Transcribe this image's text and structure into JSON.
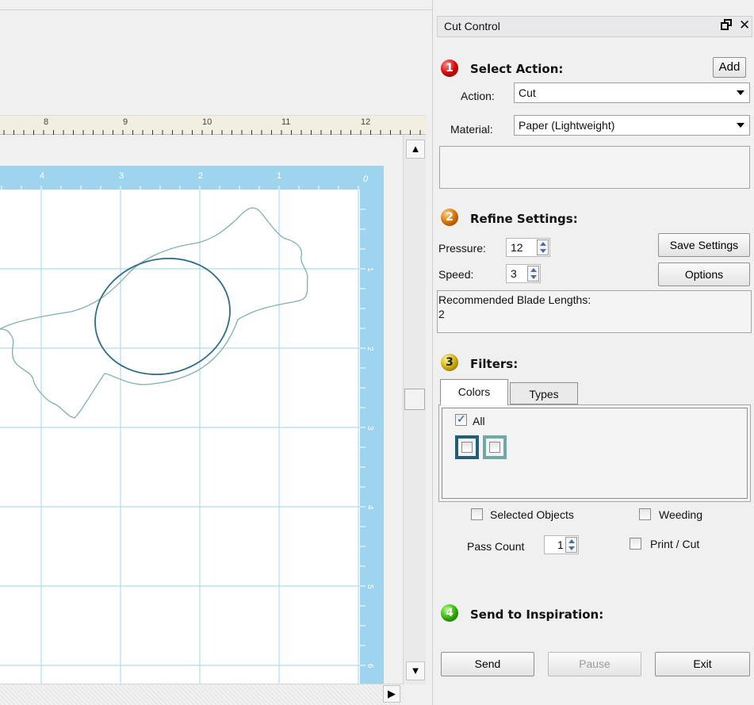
{
  "canvas": {
    "ruler_h_labels": [
      "8",
      "9",
      "10",
      "11",
      "12"
    ],
    "mat_top_labels": [
      "4",
      "3",
      "2",
      "1",
      "0"
    ],
    "mat_side_labels": [
      "1",
      "2",
      "3",
      "4",
      "5",
      "6"
    ]
  },
  "panel": {
    "title": "Cut Control",
    "step1": {
      "number": "1",
      "title": "Select Action:",
      "add_label": "Add",
      "action_label": "Action:",
      "action_value": "Cut",
      "material_label": "Material:",
      "material_value": "Paper (Lightweight)",
      "description": ""
    },
    "step2": {
      "number": "2",
      "title": "Refine Settings:",
      "pressure_label": "Pressure:",
      "pressure_value": "12",
      "speed_label": "Speed:",
      "speed_value": "3",
      "save_settings_label": "Save Settings",
      "options_label": "Options",
      "blade_heading": "Recommended Blade Lengths:",
      "blade_value": "2"
    },
    "step3": {
      "number": "3",
      "title": "Filters:",
      "tabs": [
        "Colors",
        "Types"
      ],
      "all_label": "All",
      "all_checked": true,
      "swatch_colors": [
        "#1f5f7a",
        "#6fa9a5"
      ],
      "selected_objects_label": "Selected Objects",
      "weeding_label": "Weeding",
      "pass_count_label": "Pass Count",
      "pass_count_value": "1",
      "print_cut_label": "Print / Cut"
    },
    "step4": {
      "number": "4",
      "title": "Send to Inspiration:",
      "send_label": "Send",
      "pause_label": "Pause",
      "exit_label": "Exit"
    }
  },
  "colors": {
    "mat_blue": "#9fd4ef",
    "grid_line": "#aedcf0",
    "shape_outer": "#7fb0b0",
    "shape_inner": "#2e6e86"
  }
}
